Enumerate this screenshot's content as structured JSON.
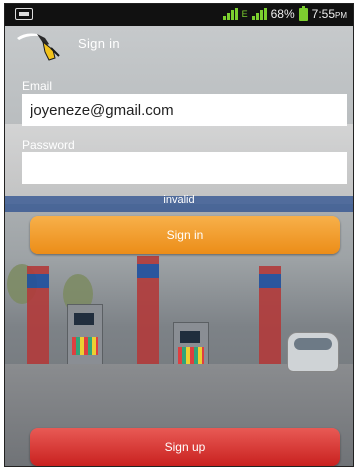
{
  "status_bar": {
    "battery_percent": "68%",
    "time": "7:55",
    "time_suffix": "PM",
    "network_label": "E",
    "icons": [
      "screenshot-icon",
      "signal-icon",
      "battery-icon"
    ]
  },
  "header": {
    "title": "Sign in",
    "icon": "fuel-pump-icon"
  },
  "form": {
    "email_label": "Email",
    "email_value": "joyeneze@gmail.com",
    "password_label": "Password",
    "password_value": "",
    "status_message": "invalid",
    "signin_label": "Sign in",
    "signup_label": "Sign up"
  },
  "colors": {
    "signin_button": "#ec8d18",
    "signup_button": "#c9211f",
    "status_bar": "#111111",
    "signal_green": "#7ccf2f"
  }
}
